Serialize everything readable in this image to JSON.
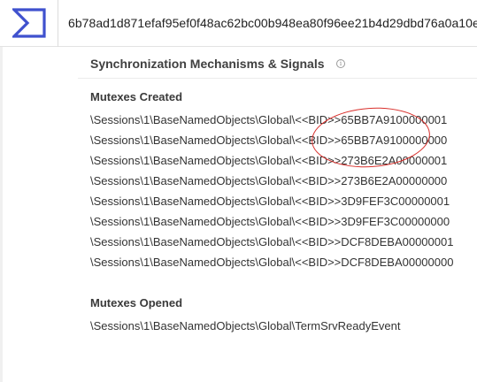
{
  "header": {
    "logo_icon": "sigma-icon",
    "accent_color": "#3f51ce",
    "hash": "6b78ad1d871efaf95ef0f48ac62bc00b948ea80f96ee21b4d29dbd76a0a10e"
  },
  "section": {
    "title": "Synchronization Mechanisms & Signals",
    "info_icon": "info-icon",
    "info_glyph": "i"
  },
  "mutexes_created": {
    "title": "Mutexes Created",
    "items": [
      "\\Sessions\\1\\BaseNamedObjects\\Global\\<<BID>>65BB7A9100000001",
      "\\Sessions\\1\\BaseNamedObjects\\Global\\<<BID>>65BB7A9100000000",
      "\\Sessions\\1\\BaseNamedObjects\\Global\\<<BID>>273B6E2A00000001",
      "\\Sessions\\1\\BaseNamedObjects\\Global\\<<BID>>273B6E2A00000000",
      "\\Sessions\\1\\BaseNamedObjects\\Global\\<<BID>>3D9FEF3C00000001",
      "\\Sessions\\1\\BaseNamedObjects\\Global\\<<BID>>3D9FEF3C00000000",
      "\\Sessions\\1\\BaseNamedObjects\\Global\\<<BID>>DCF8DEBA00000001",
      "\\Sessions\\1\\BaseNamedObjects\\Global\\<<BID>>DCF8DEBA00000000"
    ]
  },
  "mutexes_opened": {
    "title": "Mutexes Opened",
    "items": [
      "\\Sessions\\1\\BaseNamedObjects\\Global\\TermSrvReadyEvent"
    ]
  },
  "annotation_color": "#d9302c"
}
